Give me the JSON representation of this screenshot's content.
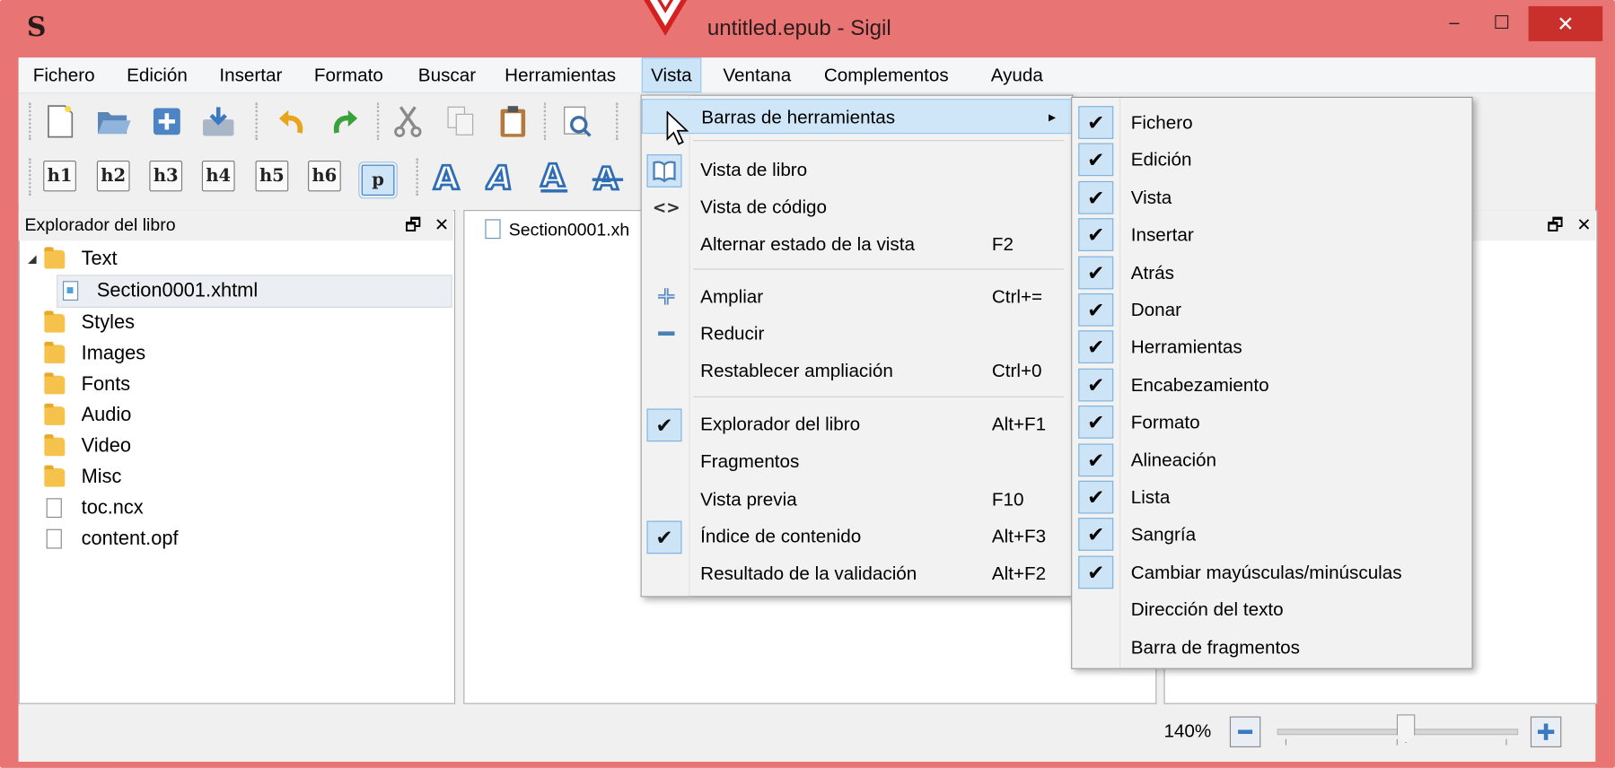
{
  "window": {
    "app_logo": "S",
    "title": "untitled.epub - Sigil",
    "minimize_glyph": "‒",
    "maximize_glyph": "☐",
    "close_glyph": "✕"
  },
  "menubar": [
    {
      "label": "Fichero"
    },
    {
      "label": "Edición"
    },
    {
      "label": "Insertar"
    },
    {
      "label": "Formato"
    },
    {
      "label": "Buscar"
    },
    {
      "label": "Herramientas"
    },
    {
      "label": "Vista"
    },
    {
      "label": "Ventana"
    },
    {
      "label": "Complementos"
    },
    {
      "label": "Ayuda"
    }
  ],
  "heading_buttons": [
    "h1",
    "h2",
    "h3",
    "h4",
    "h5",
    "h6",
    "p"
  ],
  "book_browser": {
    "title": "Explorador del libro",
    "float_glyph": "🗗",
    "close_glyph": "✕",
    "items": [
      {
        "label": "Text",
        "type": "folder",
        "expanded": true
      },
      {
        "label": "Section0001.xhtml",
        "type": "xhtml",
        "selected": true
      },
      {
        "label": "Styles",
        "type": "folder"
      },
      {
        "label": "Images",
        "type": "folder"
      },
      {
        "label": "Fonts",
        "type": "folder"
      },
      {
        "label": "Audio",
        "type": "folder"
      },
      {
        "label": "Video",
        "type": "folder"
      },
      {
        "label": "Misc",
        "type": "folder"
      },
      {
        "label": "toc.ncx",
        "type": "file"
      },
      {
        "label": "content.opf",
        "type": "file"
      }
    ]
  },
  "editor_tab": {
    "label": "Section0001.xh"
  },
  "right_pane": {
    "float_glyph": "🗗",
    "close_glyph": "✕"
  },
  "vista_menu": {
    "toolbars": {
      "label": "Barras de herramientas",
      "arrow": "▸"
    },
    "book_view": {
      "label": "Vista de libro"
    },
    "code_view": {
      "label": "Vista de código",
      "icon_glyph": "<>"
    },
    "toggle_view": {
      "label": "Alternar estado de la vista",
      "shortcut": "F2"
    },
    "zoom_in": {
      "label": "Ampliar",
      "shortcut": "Ctrl+="
    },
    "zoom_out": {
      "label": "Reducir"
    },
    "zoom_reset": {
      "label": "Restablecer ampliación",
      "shortcut": "Ctrl+0"
    },
    "book_browser": {
      "label": "Explorador del libro",
      "shortcut": "Alt+F1",
      "checked": true
    },
    "clips": {
      "label": "Fragmentos"
    },
    "preview": {
      "label": "Vista previa",
      "shortcut": "F10"
    },
    "toc": {
      "label": "Índice de contenido",
      "shortcut": "Alt+F3",
      "checked": true
    },
    "validation": {
      "label": "Resultado de la validación",
      "shortcut": "Alt+F2"
    },
    "check_glyph": "✔"
  },
  "toolbars_submenu": [
    {
      "label": "Fichero",
      "checked": true
    },
    {
      "label": "Edición",
      "checked": true
    },
    {
      "label": "Vista",
      "checked": true
    },
    {
      "label": "Insertar",
      "checked": true
    },
    {
      "label": "Atrás",
      "checked": true
    },
    {
      "label": "Donar",
      "checked": true
    },
    {
      "label": "Herramientas",
      "checked": true
    },
    {
      "label": "Encabezamiento",
      "checked": true
    },
    {
      "label": "Formato",
      "checked": true
    },
    {
      "label": "Alineación",
      "checked": true
    },
    {
      "label": "Lista",
      "checked": true
    },
    {
      "label": "Sangría",
      "checked": true
    },
    {
      "label": "Cambiar mayúsculas/minúsculas",
      "checked": true
    },
    {
      "label": "Dirección del texto",
      "checked": false
    },
    {
      "label": "Barra de fragmentos",
      "checked": false
    }
  ],
  "statusbar": {
    "zoom": "140%",
    "zoom_level_fraction": 0.53
  },
  "colors": {
    "title_bar": "#e87474",
    "close_button": "#c9302c",
    "highlight": "#cfe5f8",
    "accent": "#3a7dc0"
  }
}
